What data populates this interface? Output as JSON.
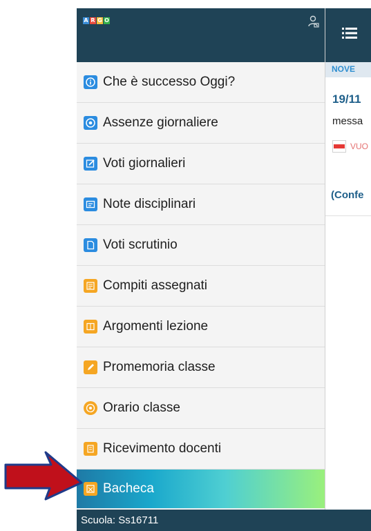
{
  "drawer": {
    "logo_letters": [
      "A",
      "R",
      "G",
      "O"
    ],
    "logo_colors": [
      "#3b8ed8",
      "#e84c3d",
      "#f6c23e",
      "#37b34a"
    ],
    "user_icon": "user-settings-icon",
    "items": [
      {
        "label": "Che è successo Oggi?",
        "icon": "info-icon",
        "color": "#2b8ce0"
      },
      {
        "label": "Assenze giornaliere",
        "icon": "clock-icon",
        "color": "#2b8ce0"
      },
      {
        "label": "Voti giornalieri",
        "icon": "edit-icon",
        "color": "#2b8ce0"
      },
      {
        "label": "Note disciplinari",
        "icon": "note-icon",
        "color": "#2b8ce0"
      },
      {
        "label": "Voti scrutinio",
        "icon": "document-icon",
        "color": "#2b8ce0"
      },
      {
        "label": "Compiti assegnati",
        "icon": "tasks-icon",
        "color": "#f5a623"
      },
      {
        "label": "Argomenti lezione",
        "icon": "book-icon",
        "color": "#f5a623"
      },
      {
        "label": "Promemoria classe",
        "icon": "pencil-icon",
        "color": "#f5a623"
      },
      {
        "label": "Orario classe",
        "icon": "clock-icon",
        "color": "#f5a623"
      },
      {
        "label": "Ricevimento docenti",
        "icon": "calendar-icon",
        "color": "#f5a623"
      },
      {
        "label": "Bacheca",
        "icon": "board-icon",
        "color": "#f5a623",
        "active": true
      }
    ]
  },
  "footer": {
    "school": "Scuola: Ss16711"
  },
  "content": {
    "menu_icon": "hamburger-icon",
    "month": "NOVE",
    "date": "19/11",
    "message": "messa",
    "attachment": "VUO",
    "confirm": "(Confe"
  },
  "annotation": {
    "arrow_color": "#c0101b"
  }
}
